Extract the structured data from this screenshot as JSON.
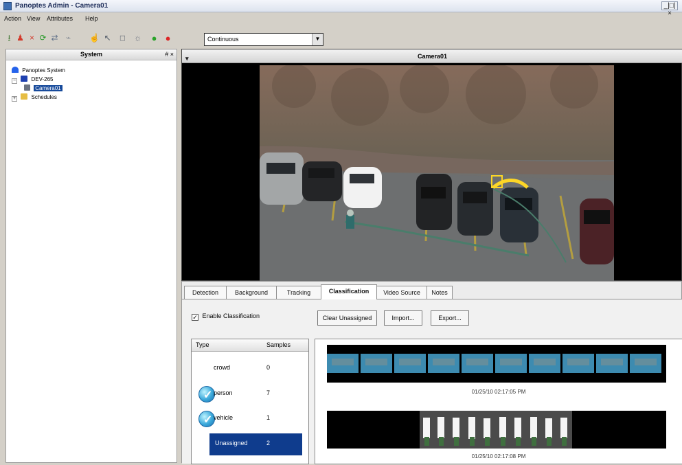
{
  "window": {
    "title": "Panoptes Admin - Camera01",
    "controls": "_|□|×"
  },
  "menu": [
    "Action",
    "View",
    "Attributes",
    "Help"
  ],
  "toolbar": {
    "mode": "Continuous",
    "icons": [
      "download-icon",
      "person-icon",
      "x-icon",
      "refresh-icon",
      "share-icon",
      "path-icon",
      "hand-icon",
      "pointer-icon",
      "rectangle-icon",
      "bulb-icon",
      "play-icon",
      "stop-icon"
    ]
  },
  "left_pane": {
    "title": "System",
    "header_buttons": "# ×",
    "tree": [
      {
        "label": "Panoptes System",
        "expander": "",
        "icon": "system-icon"
      },
      {
        "label": "DEV-265",
        "expander": "−",
        "icon": "server-icon"
      },
      {
        "label": "Camera01",
        "expander": "",
        "icon": "camera-icon",
        "selected": true
      },
      {
        "label": "Schedules",
        "expander": "+",
        "icon": "folder-icon"
      }
    ]
  },
  "camera": {
    "title": "Camera01",
    "dropdown": "▾"
  },
  "tabs": [
    "Detection",
    "Background",
    "Tracking",
    "Classification",
    "Video Source",
    "Notes"
  ],
  "active_tab": "Classification",
  "classification": {
    "enable_label": "Enable Classification",
    "enable_checked": "✓",
    "buttons": {
      "clear": "Clear Unassigned",
      "import": "Import...",
      "export": "Export..."
    },
    "table": {
      "headers": [
        "Type",
        "Samples"
      ],
      "rows": [
        {
          "type": "crowd",
          "samples": "0",
          "checked": false,
          "selected": false
        },
        {
          "type": "person",
          "samples": "7",
          "checked": true,
          "selected": false
        },
        {
          "type": "vehicle",
          "samples": "1",
          "checked": true,
          "selected": false
        },
        {
          "type": "Unassigned",
          "samples": "2",
          "checked": false,
          "selected": true
        }
      ]
    },
    "samples": [
      {
        "timestamp": "01/25/10 02:17:05 PM"
      },
      {
        "timestamp": "01/25/10 02:17:08 PM"
      }
    ]
  }
}
